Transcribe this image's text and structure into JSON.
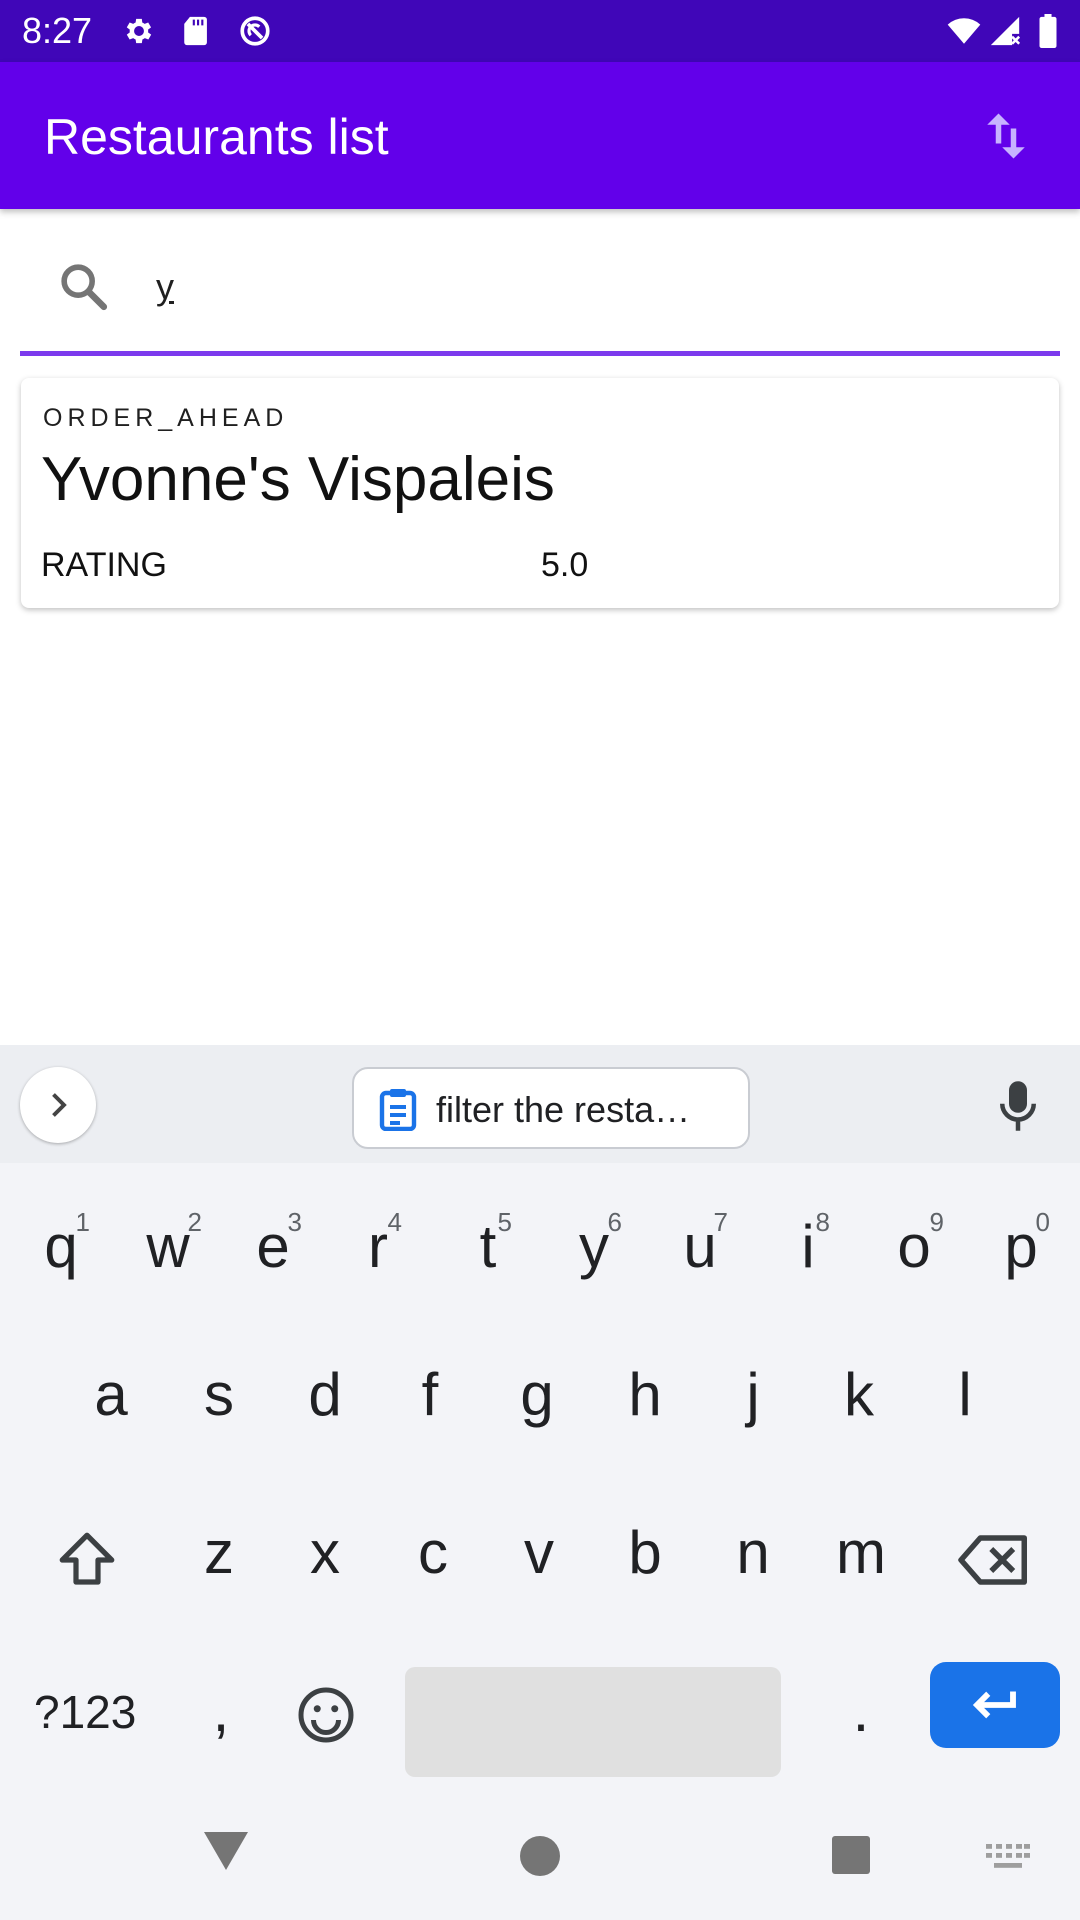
{
  "status_bar": {
    "time": "8:27",
    "left_icons": [
      "gear-icon",
      "sd-card-icon",
      "app-badge-icon"
    ],
    "right_icons": [
      "wifi-icon",
      "cell-signal-icon",
      "battery-icon"
    ]
  },
  "app_bar": {
    "title": "Restaurants list",
    "sort_icon": "sort-icon",
    "background": "#6200ea"
  },
  "search": {
    "value": "y",
    "underline_color": "#7c3aed"
  },
  "results": [
    {
      "type": "ORDER_AHEAD",
      "name": "Yvonne's Vispaleis",
      "rating_label": "RATING",
      "rating_value": "5.0"
    }
  ],
  "keyboard": {
    "suggestion_chip": "filter the resta…",
    "row1": [
      {
        "key": "q",
        "hint": "1"
      },
      {
        "key": "w",
        "hint": "2"
      },
      {
        "key": "e",
        "hint": "3"
      },
      {
        "key": "r",
        "hint": "4"
      },
      {
        "key": "t",
        "hint": "5"
      },
      {
        "key": "y",
        "hint": "6"
      },
      {
        "key": "u",
        "hint": "7"
      },
      {
        "key": "i",
        "hint": "8"
      },
      {
        "key": "o",
        "hint": "9"
      },
      {
        "key": "p",
        "hint": "0"
      }
    ],
    "row2": [
      "a",
      "s",
      "d",
      "f",
      "g",
      "h",
      "j",
      "k",
      "l"
    ],
    "row3": [
      "z",
      "x",
      "c",
      "v",
      "b",
      "n",
      "m"
    ],
    "symbols_label": "?123",
    "comma": ",",
    "period": ".",
    "enter_color": "#1a73e8"
  }
}
